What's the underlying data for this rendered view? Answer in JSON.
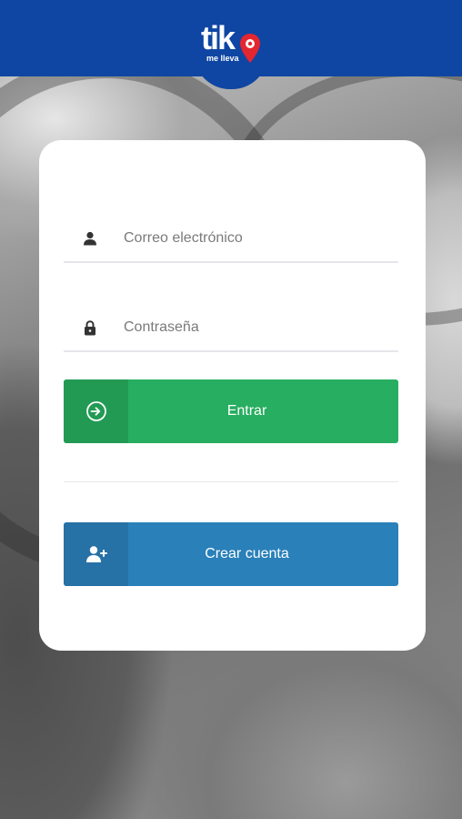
{
  "header": {
    "logo_word": "tik",
    "logo_subtitle": "me lleva",
    "bar_color": "#0f46a3",
    "pin_color": "#e3262f"
  },
  "login": {
    "email": {
      "icon": "user-icon",
      "placeholder": "Correo electrónico",
      "value": ""
    },
    "password": {
      "icon": "lock-icon",
      "placeholder": "Contraseña",
      "value": ""
    },
    "login_button": {
      "icon": "sign-in-icon",
      "label": "Entrar",
      "color": "#27ae60"
    },
    "create_button": {
      "icon": "user-plus-icon",
      "label": "Crear cuenta",
      "color": "#2a80b9"
    }
  }
}
